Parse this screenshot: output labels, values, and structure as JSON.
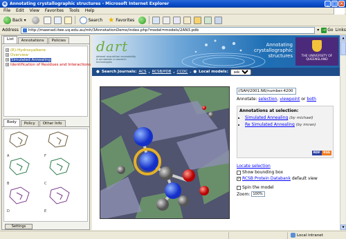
{
  "window": {
    "title": "Annotating crystallographic structures - Microsoft Internet Explorer"
  },
  "menu": [
    "File",
    "Edit",
    "View",
    "Favorites",
    "Tools",
    "Help"
  ],
  "toolbar": {
    "back": "Back",
    "search": "Search",
    "favorites": "Favorites"
  },
  "address": {
    "label": "Address",
    "url": "http://maenad.itee.uq.edu.au/mh/3AnnotationDemo/index.php?model=models/2AN3.pdb",
    "go": "Go",
    "links": "Links"
  },
  "left_panel": {
    "tabs": [
      "List",
      "Annotations",
      "Policies"
    ],
    "tree": [
      {
        "label": "(R)-Hydroxyalkene",
        "style": "normal"
      },
      {
        "label": "Overview",
        "style": "normal"
      },
      {
        "label": "Simulated Annealing",
        "style": "selected"
      },
      {
        "label": "Identification of Residues and Interactions",
        "style": "red"
      }
    ],
    "bottom_tabs": [
      "Body",
      "Policy",
      "Other Info"
    ],
    "thumb_labels": [
      "A",
      "B",
      "C",
      "D",
      "E",
      "F"
    ],
    "settings": "Settings"
  },
  "banner": {
    "logo": "dart",
    "tagline": "dataset acquisition accessibility & annotation e-research technologies",
    "title": "Annotating crystallographic structures",
    "uq": "THE UNIVERSITY OF QUEENSLAND"
  },
  "searchbar": {
    "label": "Search Journals:",
    "links": [
      "ACS",
      "RCSB/PDB",
      "CCDC"
    ],
    "local_label": "Local models:",
    "select_value": "select"
  },
  "panel": {
    "path_value": "//SAH/2001.N6/number:4200",
    "annotate_label": "Annotate:",
    "annotate_links": [
      "selection",
      "viewpoint",
      "both"
    ],
    "annotate_or": "or",
    "annotations_heading": "Annotations at selection:",
    "annotations": [
      {
        "title": "Simulated Annealing",
        "by": "(by michael)"
      },
      {
        "title": "Re Simulated Annealing",
        "by": "(by imran)"
      }
    ],
    "rdf": "RDF",
    "rss": "RSS",
    "locate": "Locate selection",
    "show_bbox": "Show bounding box",
    "rcsb": "RCSB Protein Databank",
    "default_view": "default view",
    "spin": "Spin the model",
    "zoom_label": "Zoom:",
    "zoom_value": "100%"
  },
  "status": {
    "zone": "Local intranet"
  }
}
